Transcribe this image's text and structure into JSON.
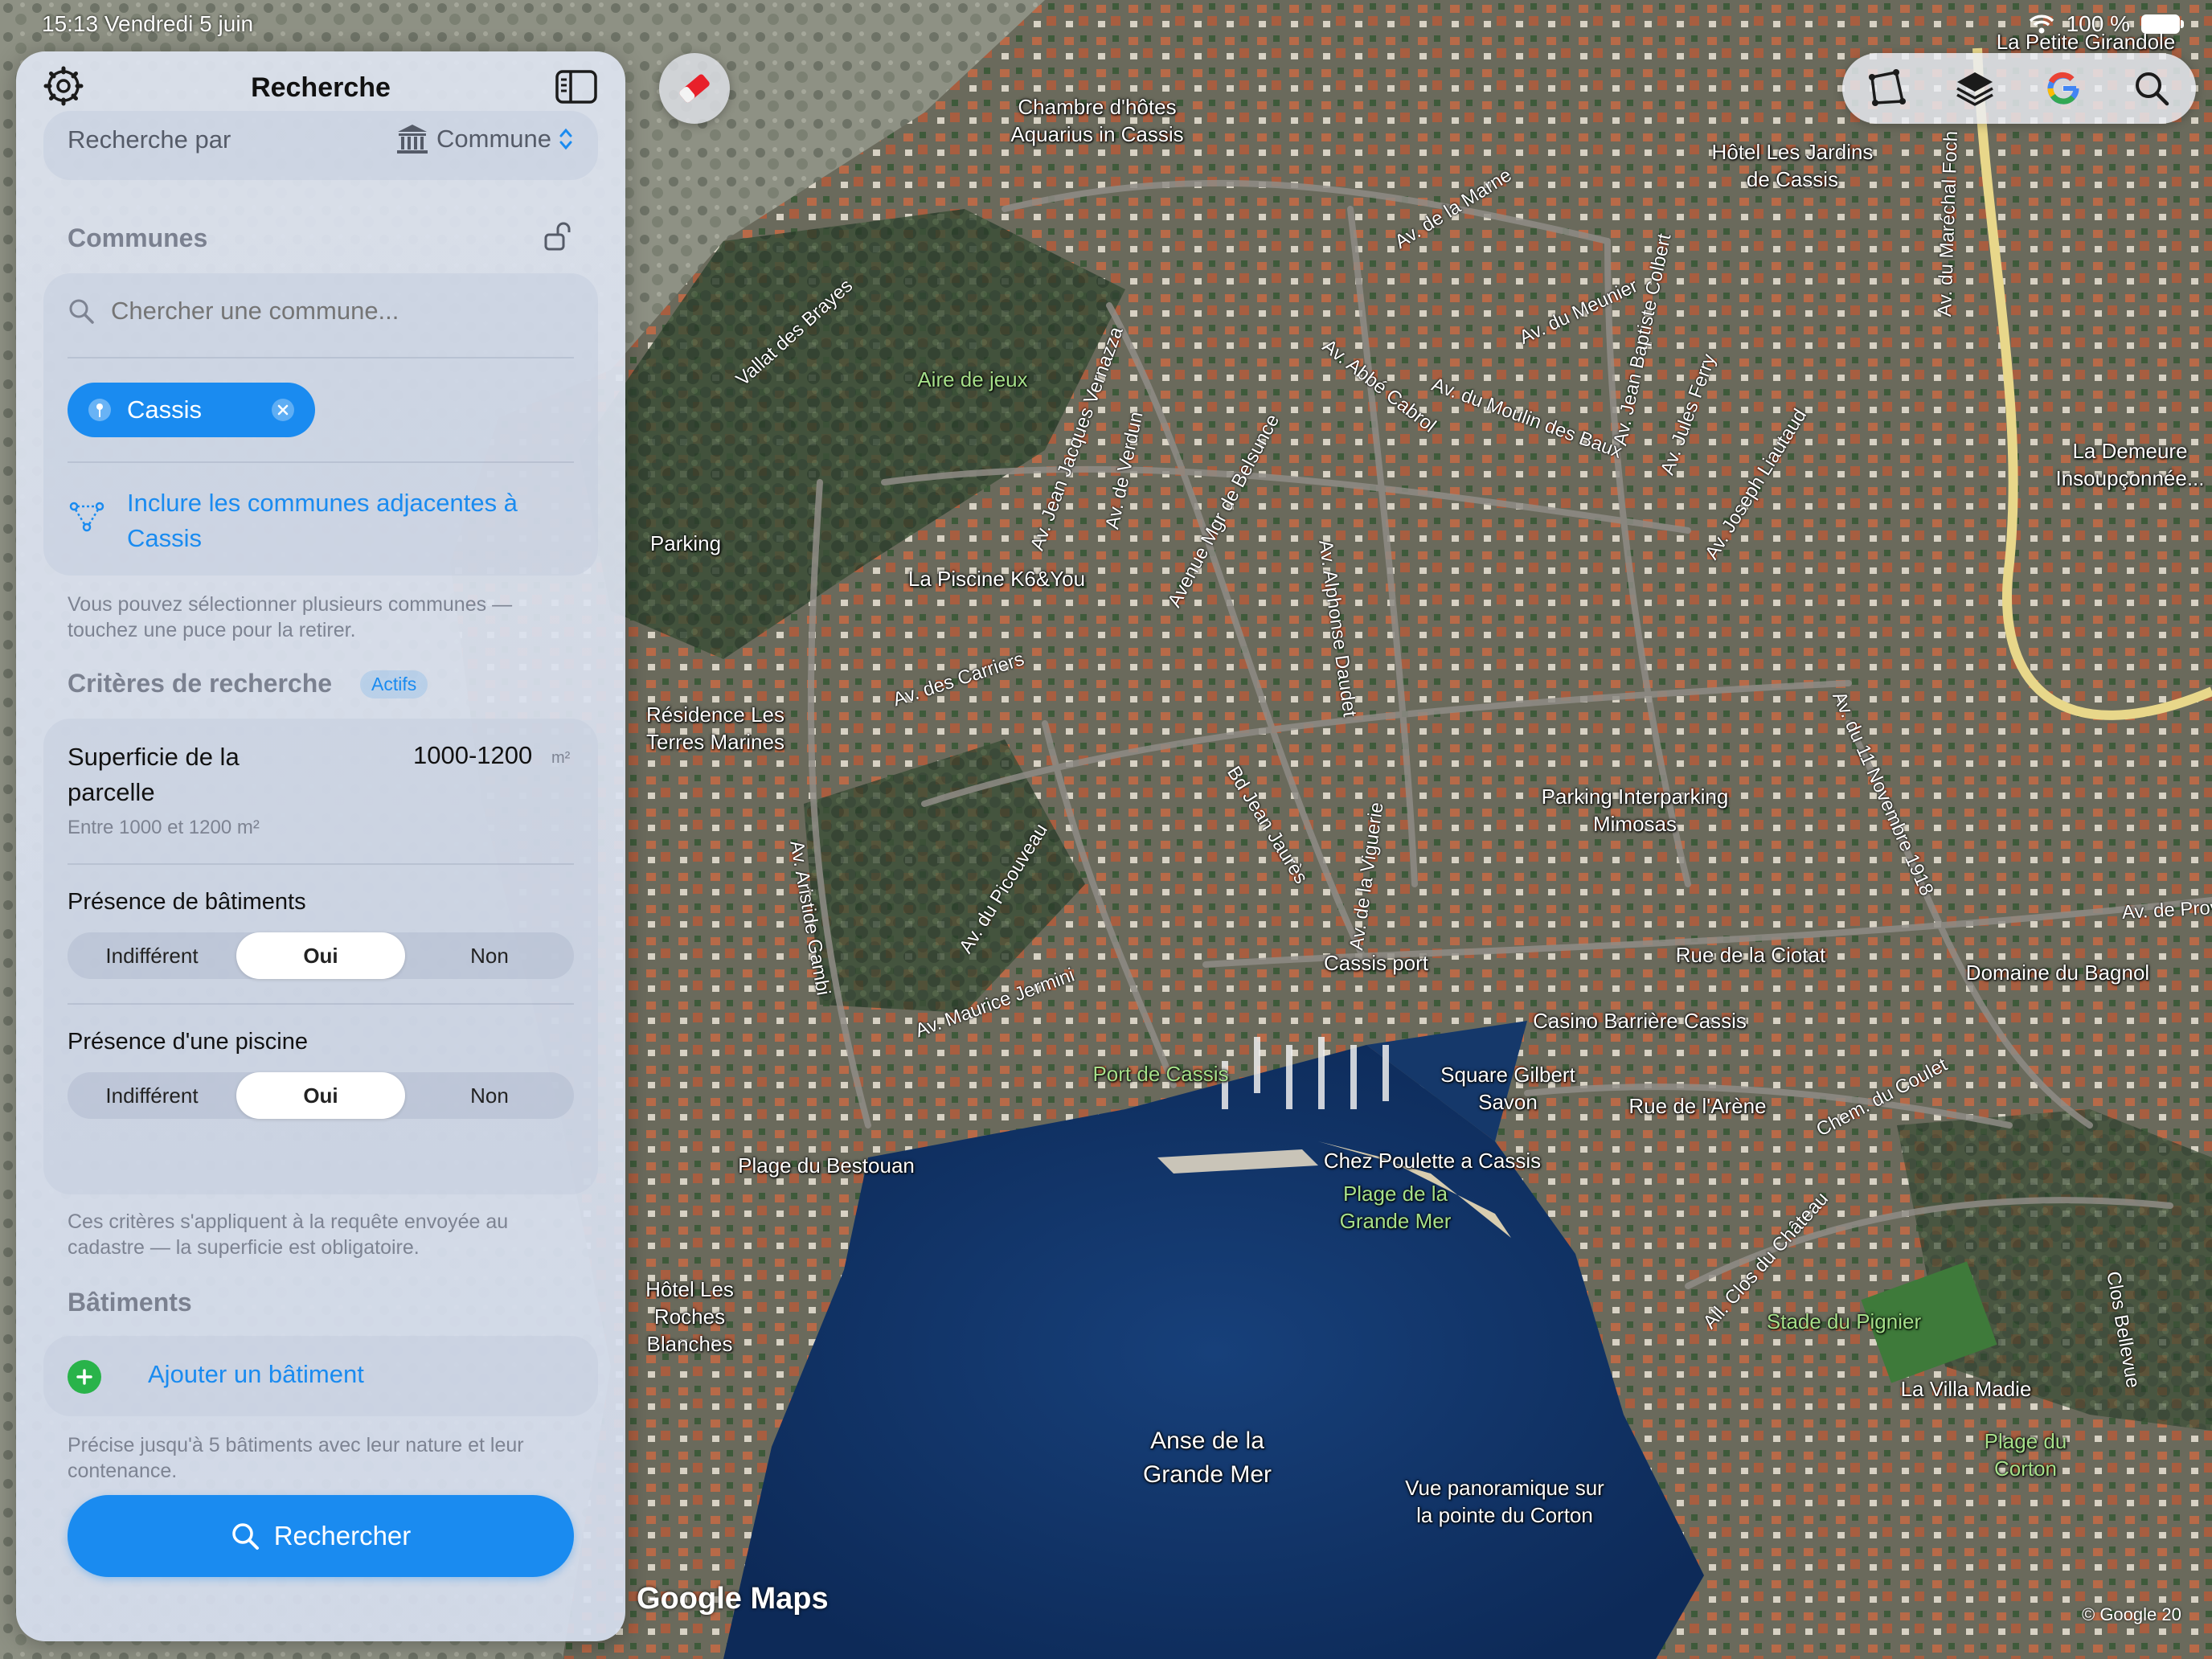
{
  "status_bar": {
    "time": "15:13",
    "date": "Vendredi 5 juin",
    "battery": "100 %"
  },
  "panel": {
    "title": "Recherche",
    "search_by": {
      "label": "Recherche par",
      "value": "Commune"
    },
    "communes": {
      "title": "Communes",
      "search_placeholder": "Chercher une commune...",
      "chips": [
        {
          "label": "Cassis"
        }
      ],
      "include_adjacent": "Inclure les communes adjacentes à Cassis",
      "help": "Vous pouvez sélectionner plusieurs communes — touchez une puce pour la retirer."
    },
    "criteria": {
      "title": "Critères de recherche",
      "badge": "Actifs",
      "area": {
        "label": "Superficie de la parcelle",
        "value": "1000-1200",
        "unit": "m²",
        "sub": "Entre 1000 et 1200 m²"
      },
      "buildings_presence": {
        "label": "Présence de bâtiments",
        "options": [
          "Indifférent",
          "Oui",
          "Non"
        ],
        "selected": "Oui"
      },
      "pool_presence": {
        "label": "Présence d'une piscine",
        "options": [
          "Indifférent",
          "Oui",
          "Non"
        ],
        "selected": "Oui"
      },
      "help": "Ces critères s'appliquent à la requête envoyée au cadastre — la superficie est obligatoire."
    },
    "buildings": {
      "title": "Bâtiments",
      "add": "Ajouter un bâtiment",
      "help": "Précise jusqu'à 5 bâtiments avec leur nature et leur contenance."
    },
    "search_button": "Rechercher"
  },
  "map": {
    "attribution_logo": "Google Maps",
    "copyright": "© Google 20",
    "places": [
      {
        "name": "La Petite Girandole",
        "green": false
      },
      {
        "name": "Chambre d'hôtes Aquarius in Cassis",
        "green": false
      },
      {
        "name": "Hôtel Les Jardins de Cassis",
        "green": false
      },
      {
        "name": "Aire de jeux",
        "green": true
      },
      {
        "name": "La Demeure Insoupçonnée...",
        "green": false
      },
      {
        "name": "Parking",
        "green": false
      },
      {
        "name": "La Piscine K6&You",
        "green": false
      },
      {
        "name": "Résidence Les Terres Marines",
        "green": false
      },
      {
        "name": "Parking Interparking Mimosas",
        "green": false
      },
      {
        "name": "Cassis port",
        "green": false
      },
      {
        "name": "Rue de la Ciotat",
        "green": false
      },
      {
        "name": "Domaine du Bagnol",
        "green": false
      },
      {
        "name": "Casino Barrière Cassis",
        "green": false
      },
      {
        "name": "Port de Cassis",
        "green": true
      },
      {
        "name": "Square Gilbert Savon",
        "green": false
      },
      {
        "name": "Rue de l'Arène",
        "green": false
      },
      {
        "name": "Plage du Bestouan",
        "green": false
      },
      {
        "name": "Chez Poulette a Cassis",
        "green": false
      },
      {
        "name": "Plage de la Grande Mer",
        "green": true
      },
      {
        "name": "Hôtel Les Roches Blanches",
        "green": false
      },
      {
        "name": "Stade du Pignier",
        "green": true
      },
      {
        "name": "La Villa Madie",
        "green": false
      },
      {
        "name": "Plage du Corton",
        "green": true
      },
      {
        "name": "Anse de la Grande Mer",
        "green": false
      },
      {
        "name": "Vue panoramique sur la pointe du Corton",
        "green": false
      }
    ],
    "roads": [
      "Vallat des Brayes",
      "Av. de la Marne",
      "Av. du Meunier",
      "Av. Jean Baptiste Colbert",
      "Av. du Maréchal Foch",
      "Av. Abbé Cabrol",
      "Av. du Moulin des Baux",
      "Av. Jules Ferry",
      "Av. Jean Jacques Vernazza",
      "Av. de Verdun",
      "Avenue Mgr de Belsunce",
      "Av. Joseph Liautaud",
      "Av. Alphonse Daudet",
      "Av. des Carriers",
      "Av. du 11 Novembre 1918",
      "Bd Jean Jaurès",
      "Av. de la Viguerie",
      "Av. Aristide Gambi",
      "Av. du Picouveau",
      "Av. Maurice Jermini",
      "Av. de Provence",
      "Chem. du Coulet",
      "All. Clos du Château",
      "Clos Bellevue"
    ]
  }
}
